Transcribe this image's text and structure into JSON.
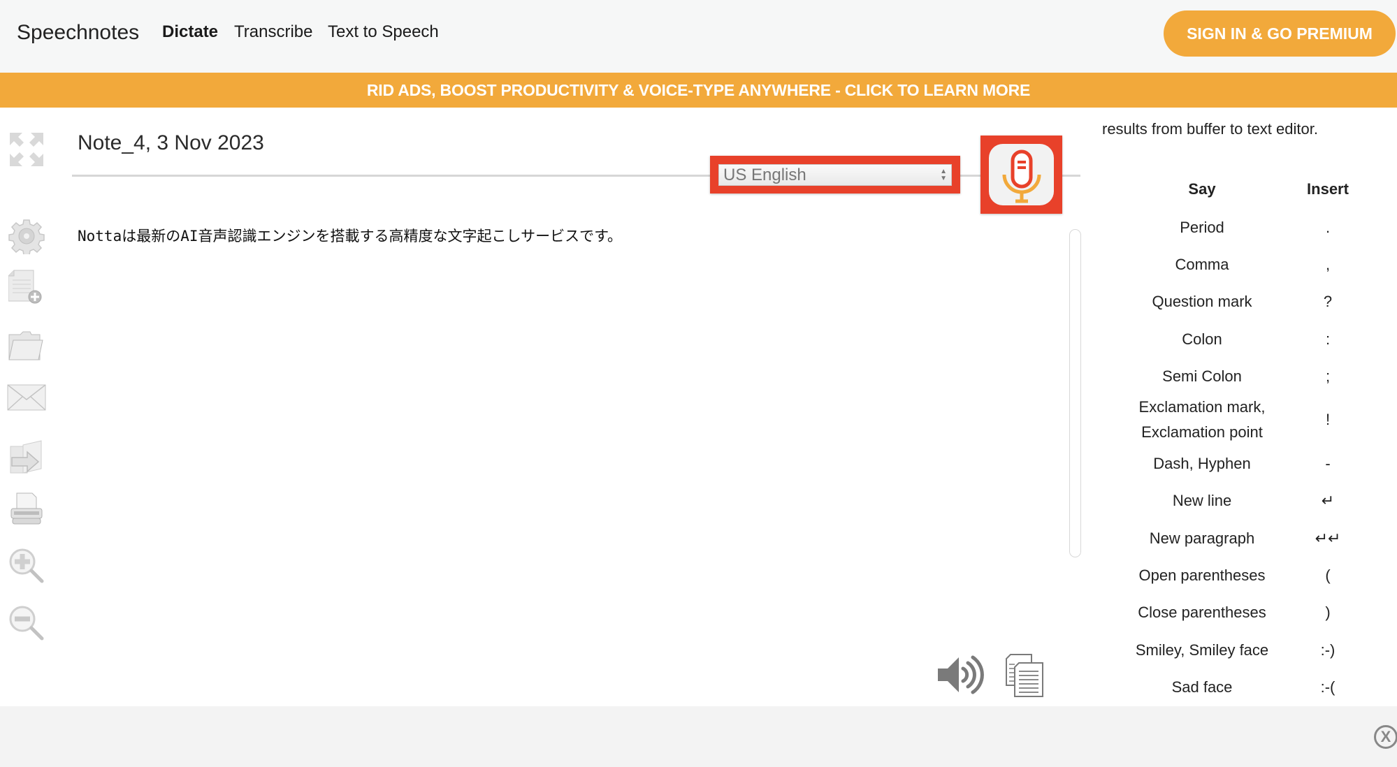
{
  "header": {
    "logo": "Speechnotes",
    "nav": [
      {
        "label": "Dictate",
        "active": true
      },
      {
        "label": "Transcribe",
        "active": false
      },
      {
        "label": "Text to Speech",
        "active": false
      }
    ],
    "premium_button": "SIGN IN & GO PREMIUM"
  },
  "banner": {
    "text": "RID ADS, BOOST PRODUCTIVITY & VOICE-TYPE ANYWHERE - CLICK TO LEARN MORE"
  },
  "toolbar": {
    "icons": [
      "fullscreen-icon",
      "settings-gear-icon",
      "new-note-icon",
      "open-folder-icon",
      "email-icon",
      "export-icon",
      "print-icon",
      "zoom-in-icon",
      "zoom-out-icon"
    ]
  },
  "editor": {
    "note_title": "Note_4, 3 Nov 2023",
    "language": {
      "selected": "US English"
    },
    "content": "Nottaは最新のAI音声認識エンジンを搭載する高精度な文字起こしサービスです。",
    "bottom_icons": [
      "speaker-icon",
      "copy-clipboard-icon"
    ]
  },
  "commands_panel": {
    "intro_text": "results from buffer to text editor.",
    "headers": {
      "say": "Say",
      "insert": "Insert"
    },
    "rows": [
      {
        "say": "Period",
        "insert": "."
      },
      {
        "say": "Comma",
        "insert": ","
      },
      {
        "say": "Question mark",
        "insert": "?"
      },
      {
        "say": "Colon",
        "insert": ":"
      },
      {
        "say": "Semi Colon",
        "insert": ";"
      },
      {
        "say": "Exclamation mark,\nExclamation point",
        "insert": "!"
      },
      {
        "say": "Dash, Hyphen",
        "insert": "-"
      },
      {
        "say": "New line",
        "insert": "↵"
      },
      {
        "say": "New paragraph",
        "insert": "↵↵"
      },
      {
        "say": "Open parentheses",
        "insert": "("
      },
      {
        "say": "Close parentheses",
        "insert": ")"
      },
      {
        "say": "Smiley, Smiley face",
        "insert": ":-)"
      },
      {
        "say": "Sad face",
        "insert": ":-("
      }
    ]
  },
  "footer": {
    "close_label": "X"
  },
  "colors": {
    "accent_orange": "#f2a93b",
    "highlight_red": "#e8412a",
    "header_bg": "#f6f7f7",
    "footer_bg": "#f3f3f3"
  }
}
